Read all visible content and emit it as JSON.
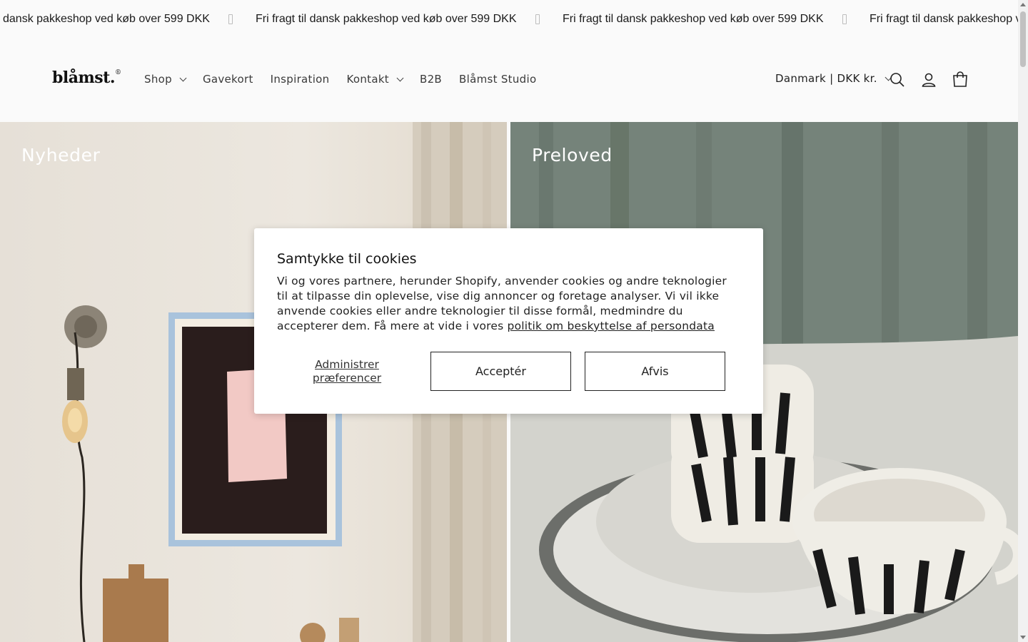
{
  "announcement": {
    "text_1": "dansk pakkeshop ved køb over 599 DKK",
    "text_2": "Fri fragt til dansk pakkeshop ved køb over 599 DKK",
    "text_3": "Fri fragt til dansk pakkeshop ved køb over 599 DKK",
    "text_4": "Fri fragt til dansk pakkeshop v"
  },
  "header": {
    "logo": "blåmst.",
    "logo_mark": "®",
    "nav": {
      "shop": "Shop",
      "gavekort": "Gavekort",
      "inspiration": "Inspiration",
      "kontakt": "Kontakt",
      "b2b": "B2B",
      "studio": "Blåmst Studio"
    },
    "country": "Danmark | DKK kr.",
    "icons": [
      "search-icon",
      "account-icon",
      "cart-icon"
    ]
  },
  "hero": {
    "left_title": "Nyheder",
    "right_title": "Preloved"
  },
  "cookie_modal": {
    "title": "Samtykke til cookies",
    "body": "Vi og vores partnere, herunder Shopify, anvender cookies og andre teknologier til at tilpasse din oplevelse, vise dig annoncer og foretage analyser. Vi vil ikke anvende cookies eller andre teknologier til disse formål, medmindre du accepterer dem. Få mere at vide i vores ",
    "policy_link": "politik om beskyttelse af persondata",
    "manage_label": "Administrer præferencer",
    "accept_label": "Acceptér",
    "reject_label": "Afvis"
  }
}
